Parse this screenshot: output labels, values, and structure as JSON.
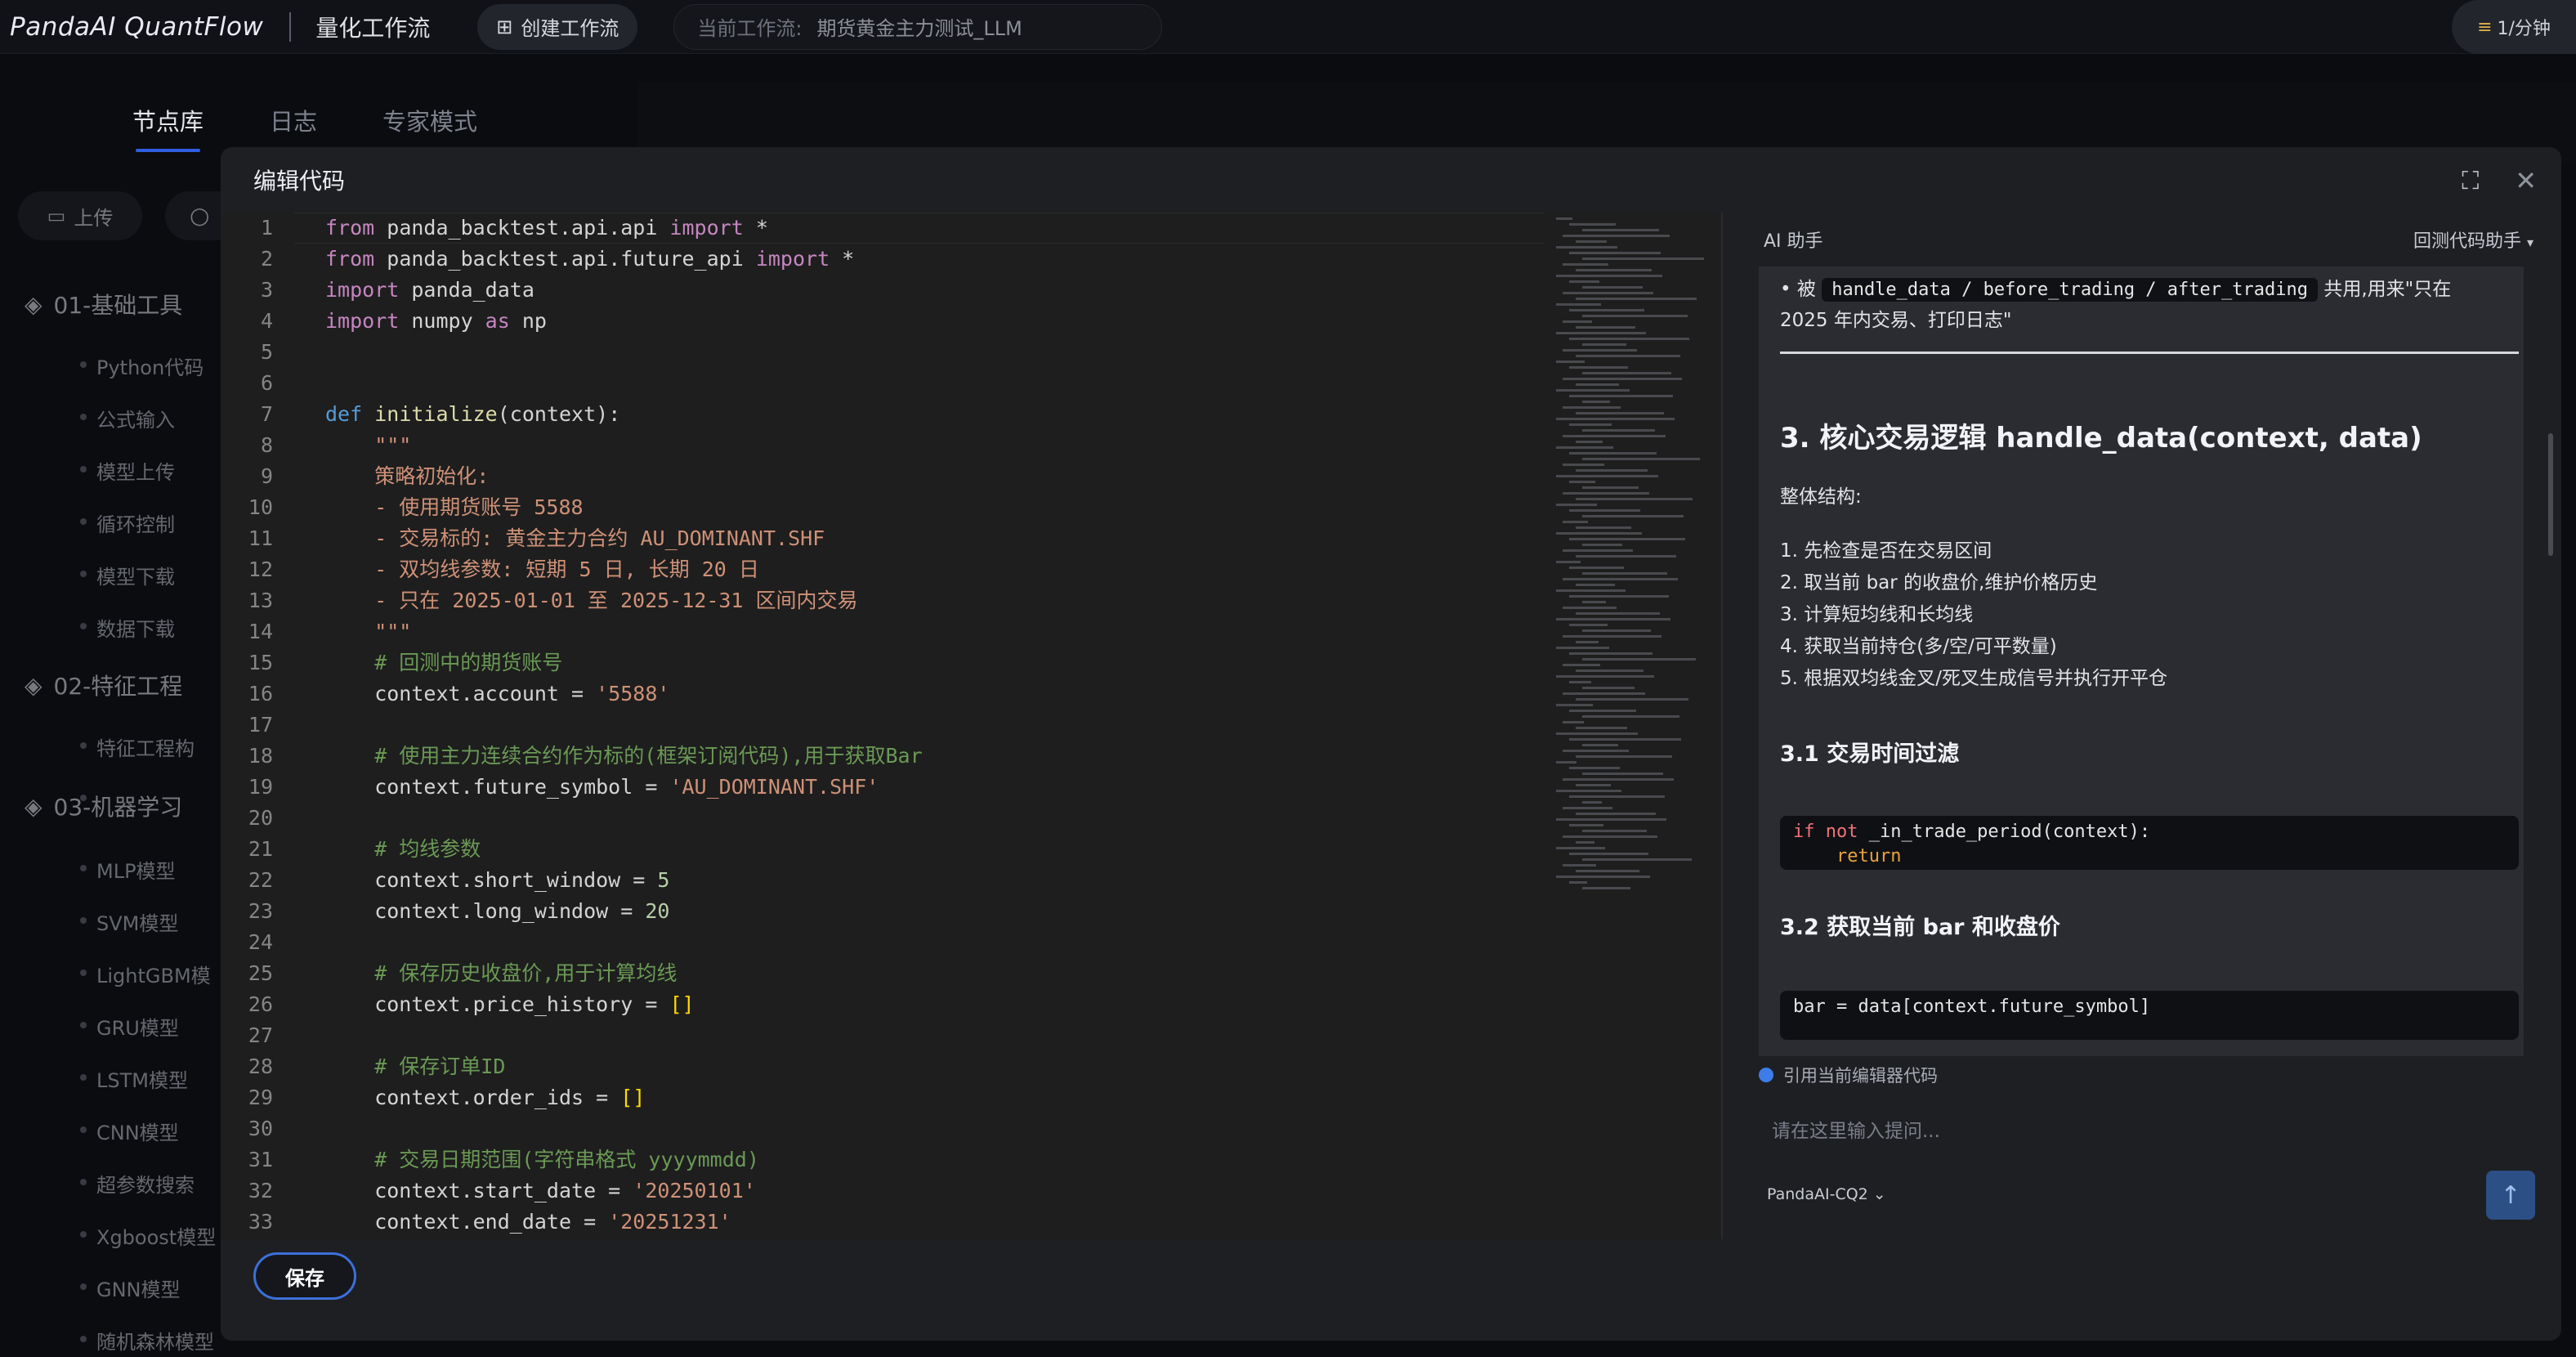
{
  "topbar": {
    "logo": "PandaAI QuantFlow",
    "subtitle": "量化工作流",
    "create_button": "创建工作流",
    "current_label": "当前工作流:",
    "current_value": "期货黄金主力测试_LLM",
    "rate": "1/分钟"
  },
  "tabs": [
    "节点库",
    "日志",
    "专家模式"
  ],
  "sidebar": {
    "upload": "上传",
    "sections": [
      {
        "title": "01-基础工具",
        "items": [
          "Python代码",
          "公式输入",
          "模型上传",
          "循环控制",
          "模型下载",
          "数据下载"
        ]
      },
      {
        "title": "02-特征工程",
        "items": [
          "特征工程构"
        ]
      },
      {
        "title": "03-机器学习",
        "items": [
          "MLP模型",
          "SVM模型",
          "LightGBM模",
          "GRU模型",
          "LSTM模型",
          "CNN模型",
          "超参数搜索",
          "Xgboost模型",
          "GNN模型",
          "随机森林模型"
        ]
      }
    ]
  },
  "modal": {
    "title": "编辑代码",
    "save": "保存"
  },
  "code_lines": [
    "from panda_backtest.api.api import *",
    "from panda_backtest.api.future_api import *",
    "import panda_data",
    "import numpy as np",
    "",
    "",
    "def initialize(context):",
    "    \"\"\"",
    "    策略初始化:",
    "    - 使用期货账号 5588",
    "    - 交易标的: 黄金主力合约 AU_DOMINANT.SHF",
    "    - 双均线参数: 短期 5 日, 长期 20 日",
    "    - 只在 2025-01-01 至 2025-12-31 区间内交易",
    "    \"\"\"",
    "    # 回测中的期货账号",
    "    context.account = '5588'",
    "",
    "    # 使用主力连续合约作为标的(框架订阅代码),用于获取Bar",
    "    context.future_symbol = 'AU_DOMINANT.SHF'",
    "",
    "    # 均线参数",
    "    context.short_window = 5",
    "    context.long_window = 20",
    "",
    "    # 保存历史收盘价,用于计算均线",
    "    context.price_history = []",
    "",
    "    # 保存订单ID",
    "    context.order_ids = []",
    "",
    "    # 交易日期范围(字符串格式 yyyymmdd)",
    "    context.start_date = '20250101'",
    "    context.end_date = '20251231'"
  ],
  "ai": {
    "title": "AI 助手",
    "mode": "回测代码助手",
    "bullet_prefix": "被",
    "bullet_code": "handle_data / before_trading / after_trading",
    "bullet_suffix": "共用,用来\"只在",
    "bullet_line2": "2025 年内交易、打印日志\"",
    "h2": "3. 核心交易逻辑 handle_data(context, data)",
    "overall": "整体结构:",
    "steps": [
      "1. 先检查是否在交易区间",
      "2. 取当前 bar 的收盘价,维护价格历史",
      "3. 计算短均线和长均线",
      "4. 获取当前持仓(多/空/可平数量)",
      "5. 根据双均线金叉/死叉生成信号并执行开平仓"
    ],
    "h3_1": "3.1 交易时间过滤",
    "code1_kw": "if not",
    "code1_rest": " _in_trade_period(context):",
    "code1_ret": "return",
    "h3_2": "3.2 获取当前 bar 和收盘价",
    "code2": "bar = data[context.future_symbol]",
    "quote": "引用当前编辑器代码",
    "placeholder": "请在这里输入提问...",
    "model": "PandaAI-CQ2"
  }
}
